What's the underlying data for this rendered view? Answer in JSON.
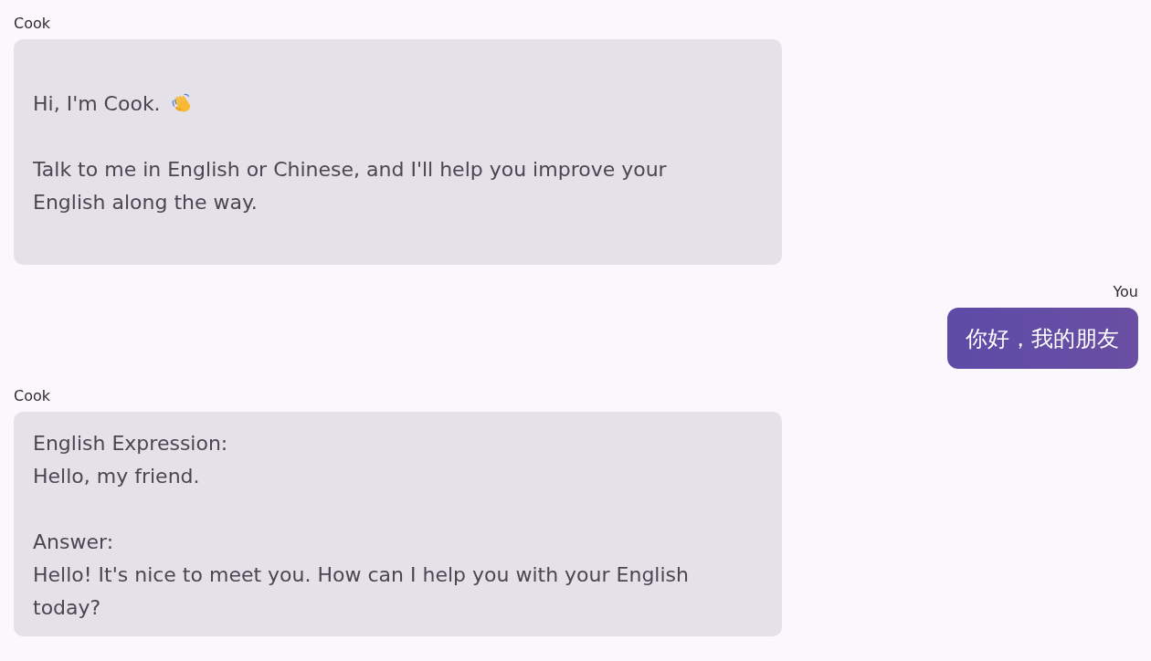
{
  "messages": [
    {
      "kind": "welcome",
      "sender": "Cook",
      "paragraphs": [
        {
          "text": "Hi, I'm Cook.",
          "wave": true
        },
        {
          "text": "Talk to me in English or Chinese, and I'll help you improve your English along the way.",
          "wave": false
        }
      ]
    },
    {
      "kind": "user",
      "sender": "You",
      "paragraphs": [
        {
          "text": "你好，我的朋友",
          "wave": false
        }
      ]
    },
    {
      "kind": "bot",
      "sender": "Cook",
      "paragraphs": [
        {
          "text": "English Expression:\nHello, my friend.",
          "wave": false
        },
        {
          "text": "Answer:\nHello! It's nice to meet you. How can I help you with your English today?",
          "wave": false
        }
      ]
    }
  ]
}
